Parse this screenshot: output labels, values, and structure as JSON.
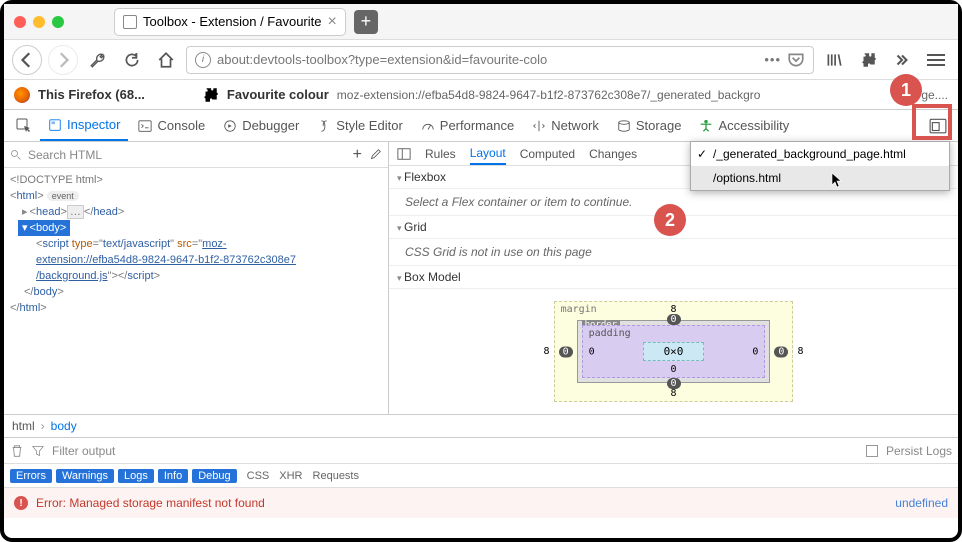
{
  "window": {
    "tab_title": "Toolbox - Extension / Favourite"
  },
  "url": "about:devtools-toolbox?type=extension&id=favourite-colo",
  "sub": {
    "this_firefox": "This Firefox (68...",
    "ext_name": "Favourite colour",
    "ext_url": "moz-extension://efba54d8-9824-9647-b1f2-873762c308e7/_generated_backgro",
    "ext_url_tail": "ge...."
  },
  "devtabs": {
    "inspector": "Inspector",
    "console": "Console",
    "debugger": "Debugger",
    "style": "Style Editor",
    "perf": "Performance",
    "network": "Network",
    "storage": "Storage",
    "a11y": "Accessibility"
  },
  "search_html": "Search HTML",
  "tree": {
    "doctype": "<!DOCTYPE html>",
    "html_open": "html",
    "event": "event",
    "head": "head",
    "ellipsis": "…",
    "body": "body",
    "script_tag": "script",
    "type_attr": "type",
    "type_val": "text/javascript",
    "src_attr": "src",
    "src_val1": "moz-",
    "src_val2": "extension://efba54d8-9824-9647-b1f2-873762c308e7",
    "src_val3": "/background.js"
  },
  "sidetabs": {
    "rules": "Rules",
    "layout": "Layout",
    "computed": "Computed",
    "changes": "Changes"
  },
  "sections": {
    "flexbox": "Flexbox",
    "flexbox_msg": "Select a Flex container or item to continue.",
    "grid": "Grid",
    "grid_msg": "CSS Grid is not in use on this page",
    "boxmodel": "Box Model"
  },
  "dropdown": {
    "item1": "/_generated_background_page.html",
    "item2": "/options.html"
  },
  "bm": {
    "margin": "margin",
    "border": "border",
    "padding": "padding",
    "content": "0×0",
    "v8": "8",
    "v0": "0"
  },
  "crumb": {
    "html": "html",
    "body": "body"
  },
  "console": {
    "filter_ph": "Filter output",
    "persist": "Persist Logs",
    "errors": "Errors",
    "warnings": "Warnings",
    "logs": "Logs",
    "info": "Info",
    "debug": "Debug",
    "css": "CSS",
    "xhr": "XHR",
    "requests": "Requests",
    "err_msg": "Error: Managed storage manifest not found",
    "undefined": "undefined"
  },
  "badges": {
    "one": "1",
    "two": "2"
  }
}
